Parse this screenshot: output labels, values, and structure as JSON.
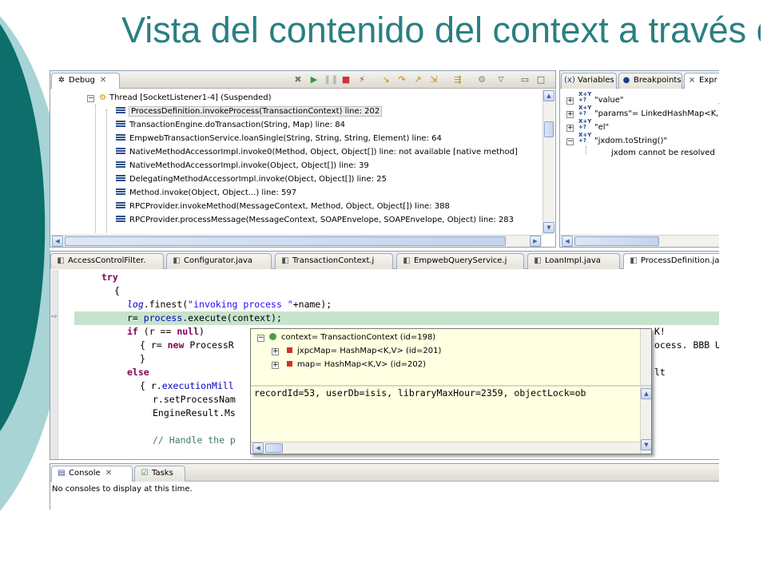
{
  "slide": {
    "title": "Vista del contenido del context a través del debug"
  },
  "colors": {
    "title": "#2a7f82",
    "deco_dark": "#0d6e6c",
    "deco_light": "#a8d4d6",
    "current_line": "#c6e3cc",
    "keyword": "#7f0055",
    "field": "#0000c0",
    "string": "#2a00ff",
    "comment": "#3f7f5f",
    "popup_bg": "#ffffe1"
  },
  "debug_view": {
    "tab_label": "Debug",
    "tab_icon": "debug-bug-icon",
    "toolbar_icons": [
      "remove-terminated-icon",
      "resume-icon",
      "suspend-icon",
      "terminate-icon",
      "disconnect-icon",
      "step-into-icon",
      "step-over-icon",
      "step-return-icon",
      "drop-to-frame-icon",
      "step-filters-icon",
      "threads-icon",
      "view-menu-icon",
      "minimize-icon",
      "maximize-icon"
    ],
    "thread_label": "Thread [SocketListener1-4] (Suspended)",
    "frames": [
      "ProcessDefinition.invokeProcess(TransactionContext) line: 202",
      "TransactionEngine.doTransaction(String, Map) line: 84",
      "EmpwebTransactionService.loanSingle(String, String, String, Element) line: 64",
      "NativeMethodAccessorImpl.invoke0(Method, Object, Object[]) line: not available [native method]",
      "NativeMethodAccessorImpl.invoke(Object, Object[]) line: 39",
      "DelegatingMethodAccessorImpl.invoke(Object, Object[]) line: 25",
      "Method.invoke(Object, Object...) line: 597",
      "RPCProvider.invokeMethod(MessageContext, Method, Object, Object[]) line: 388",
      "RPCProvider.processMessage(MessageContext, SOAPEnvelope, SOAPEnvelope, Object) line: 283"
    ]
  },
  "right_view": {
    "tabs": [
      "Variables",
      "Breakpoints",
      "Expr"
    ],
    "expressions": [
      {
        "label": "\"value\"",
        "expanded": false
      },
      {
        "label": "\"params\"= LinkedHashMap<K,V",
        "expanded": false
      },
      {
        "label": "\"el\"",
        "expanded": false
      },
      {
        "label": "\"jxdom.toString()\"",
        "expanded": true
      }
    ],
    "error_text": "jxdom cannot be resolved",
    "separator_text": "__"
  },
  "editor": {
    "tabs": [
      "AccessControlFilter.",
      "Configurator.java",
      "TransactionContext.j",
      "EmpwebQueryService.j",
      "LoanImpl.java",
      "ProcessDefinition.ja"
    ],
    "active_tab": 5,
    "code_lines": [
      {
        "kw1": "try"
      },
      {
        "text": "{"
      },
      {
        "field": "log",
        "text": ".finest(",
        "string": "\"invoking process \"",
        "text2": "+name);"
      },
      {
        "text": "r= ",
        "field2": "process",
        "text2": ".execute(context);"
      },
      {
        "kw1": "if",
        "text": " (r == ",
        "kw2": "null",
        "text2": ")",
        "tail": "K!"
      },
      {
        "text": "{ r= ",
        "kw1": "new",
        "text2": " ProcessR",
        "tail": "ocess. BBB U"
      },
      {
        "text": "}"
      },
      {
        "kw1": "else",
        "tail": "lt"
      },
      {
        "text": "{ r.",
        "field2": "executionMill"
      },
      {
        "text": "r.setProcessNam"
      },
      {
        "text": "EngineResult.Ms"
      },
      {
        "text": ""
      },
      {
        "comment": "// Handle the p"
      }
    ],
    "popup": {
      "root": "context= TransactionContext  (id=198)",
      "children": [
        "jxpcMap= HashMap<K,V>  (id=201)",
        "map= HashMap<K,V>  (id=202)"
      ],
      "detail": "recordId=53, userDb=isis, libraryMaxHour=2359, objectLock=ob"
    }
  },
  "console_view": {
    "tabs": [
      "Console",
      "Tasks"
    ],
    "message": "No consoles to display at this time."
  }
}
